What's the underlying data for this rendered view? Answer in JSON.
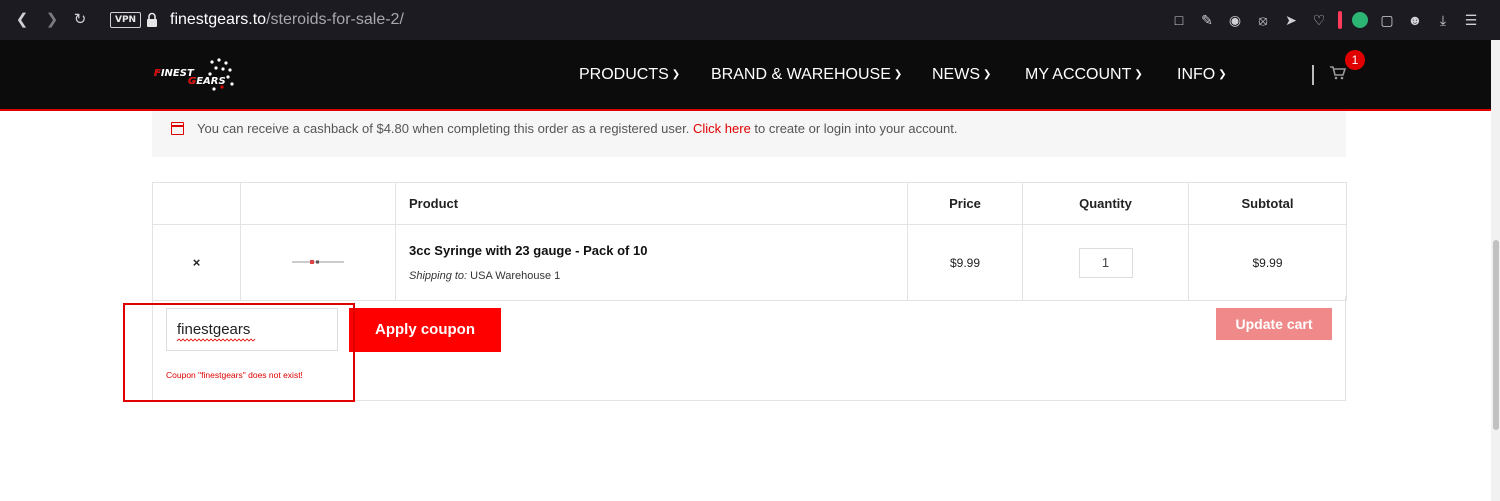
{
  "browser": {
    "vpn_label": "VPN",
    "url_host": "finestgears.to",
    "url_path": "/steroids-for-sale-2/"
  },
  "nav": {
    "logo_text": "FINEST GEARS",
    "items": [
      "PRODUCTS",
      "BRAND & WAREHOUSE",
      "NEWS",
      "MY ACCOUNT",
      "INFO"
    ],
    "cart_count": "1"
  },
  "notice": {
    "text_before": "You can receive a cashback of $4.80 when completing this order as a registered user.",
    "link_text": "Click here",
    "text_after": "to create or login into your account."
  },
  "table": {
    "headers": [
      "",
      "",
      "Product",
      "Price",
      "Quantity",
      "Subtotal"
    ],
    "rows": [
      {
        "remove": "×",
        "product": "3cc Syringe with 23 gauge - Pack of 10",
        "shipping_label": "Shipping to:",
        "shipping_value": "USA Warehouse 1",
        "price": "$9.99",
        "quantity": "1",
        "subtotal": "$9.99"
      }
    ]
  },
  "coupon": {
    "value": "finestgears",
    "apply_label": "Apply coupon",
    "error": "Coupon \"finestgears\" does not exist!"
  },
  "update_cart_label": "Update cart",
  "colors": {
    "accent": "#e00000",
    "apply_button": "#ff0000",
    "update_button_disabled": "#f08a8a",
    "nav_bg": "#0c0c0c",
    "browser_bg": "#1c1b22"
  }
}
